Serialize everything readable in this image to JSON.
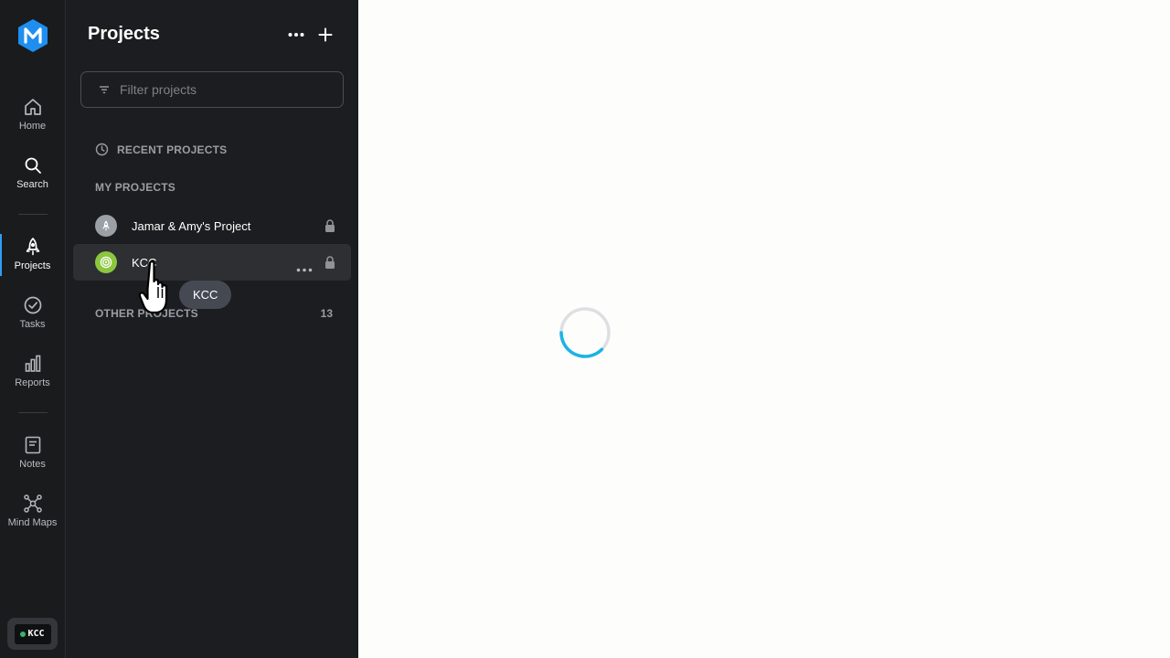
{
  "rail": {
    "items": [
      {
        "label": "Home",
        "icon": "home-icon"
      },
      {
        "label": "Search",
        "icon": "search-icon"
      },
      {
        "label": "Projects",
        "icon": "rocket-icon",
        "active": true
      },
      {
        "label": "Tasks",
        "icon": "check-circle-icon"
      },
      {
        "label": "Reports",
        "icon": "bar-chart-icon"
      },
      {
        "label": "Notes",
        "icon": "note-icon"
      },
      {
        "label": "Mind Maps",
        "icon": "mind-map-icon"
      }
    ],
    "workspace": "KCC",
    "accent_color": "#2f9df4"
  },
  "panel": {
    "title": "Projects",
    "filter": {
      "placeholder": "Filter projects",
      "value": ""
    },
    "recent_label": "RECENT PROJECTS",
    "my_label": "MY PROJECTS",
    "projects": [
      {
        "name": "Jamar & Amy's Project",
        "locked": true,
        "icon": "rocket-icon",
        "avatar_color": "#9aa0a6"
      },
      {
        "name": "KCC",
        "locked": true,
        "icon": "target-icon",
        "avatar_color": "#8cc63f",
        "hovered": true
      }
    ],
    "other_label": "OTHER PROJECTS",
    "other_count": "13"
  },
  "tooltip": "KCC",
  "content": {
    "state": "loading",
    "spinner_color": "#1ab3e6"
  }
}
